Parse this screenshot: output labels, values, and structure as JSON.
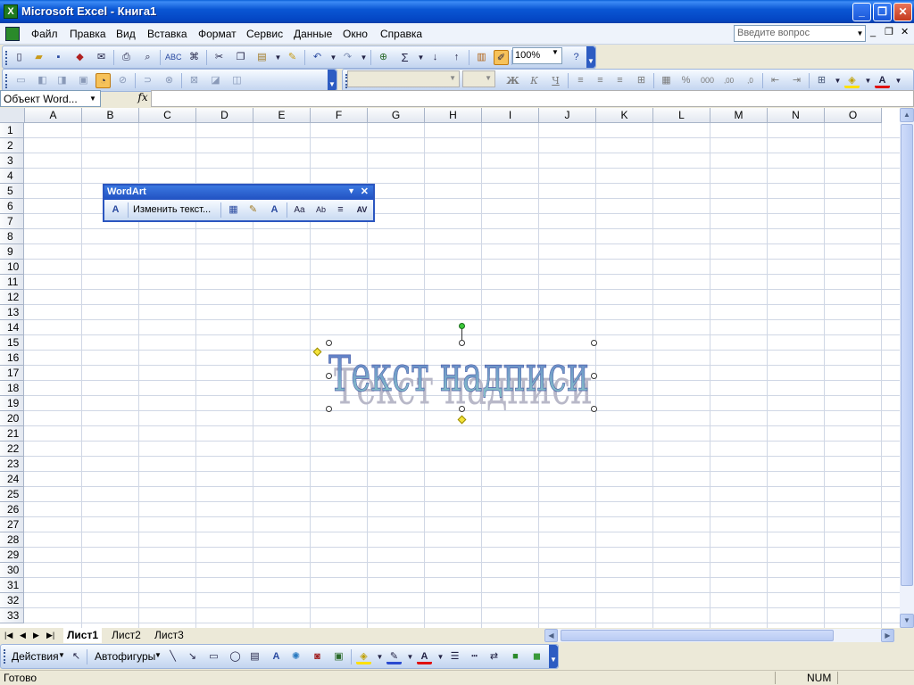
{
  "window": {
    "app_icon": "X",
    "title": "Microsoft Excel - Книга1"
  },
  "caption_buttons": {
    "minimize": "_",
    "maximize": "❐",
    "close": "✕"
  },
  "menu": {
    "items": [
      "Файл",
      "Правка",
      "Вид",
      "Вставка",
      "Формат",
      "Сервис",
      "Данные",
      "Окно",
      "Справка"
    ],
    "question_placeholder": "Введите вопрос"
  },
  "toolbar": {
    "zoom": "100%"
  },
  "formula_bar": {
    "name_box": "Объект Word...",
    "fx": "fx",
    "formula": ""
  },
  "grid": {
    "columns": [
      "A",
      "B",
      "C",
      "D",
      "E",
      "F",
      "G",
      "H",
      "I",
      "J",
      "K",
      "L",
      "M",
      "N",
      "O"
    ],
    "rows": [
      "1",
      "2",
      "3",
      "4",
      "5",
      "6",
      "7",
      "8",
      "9",
      "10",
      "11",
      "12",
      "13",
      "14",
      "15",
      "16",
      "17",
      "18",
      "19",
      "20",
      "21",
      "22",
      "23",
      "24",
      "25",
      "26",
      "27",
      "28",
      "29",
      "30",
      "31",
      "32",
      "33"
    ]
  },
  "sheets": {
    "tabs": [
      "Лист1",
      "Лист2",
      "Лист3"
    ],
    "active": "Лист1"
  },
  "drawing_toolbar": {
    "actions": "Действия",
    "autoshapes": "Автофигуры"
  },
  "status": {
    "left": "Готово",
    "num": "NUM"
  },
  "wordart_toolbar": {
    "title": "WordArt",
    "edit_text": "Изменить текст...",
    "icons": [
      "wordart-gallery-icon",
      "format-wordart-icon",
      "wordart-shape-icon",
      "same-letter-heights-icon",
      "vertical-text-icon",
      "alignment-icon",
      "character-spacing-icon"
    ]
  },
  "wordart": {
    "text": "Текст надписи",
    "colors": {
      "top": "#5a74c8",
      "bottom": "#8fd0c8"
    }
  },
  "colors": {
    "title_bar": "#0a57d4",
    "grid_lines": "#d0d7e5",
    "selection_accent": "#2b56c0"
  }
}
